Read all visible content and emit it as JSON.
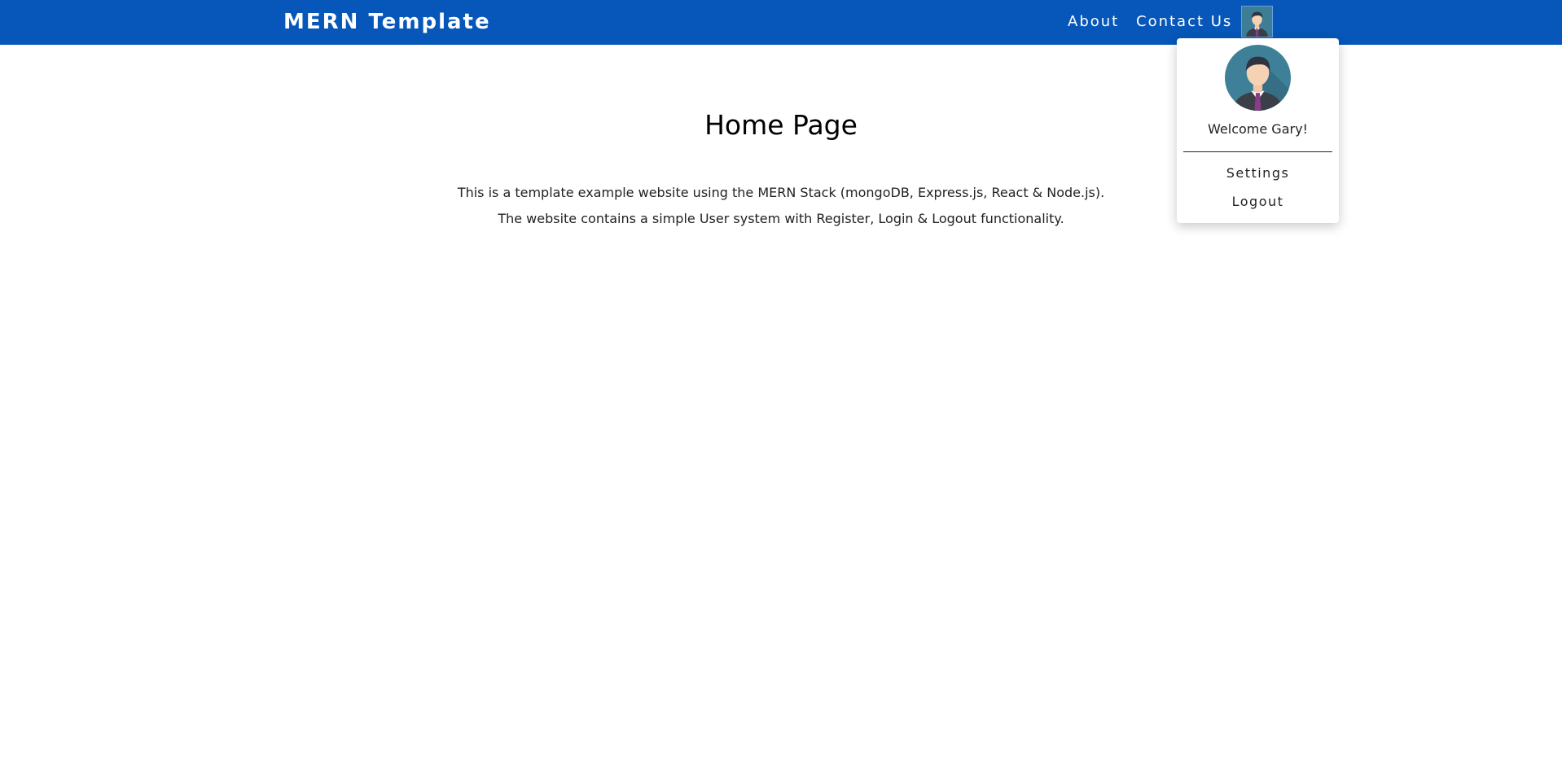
{
  "navbar": {
    "brand": "MERN Template",
    "links": [
      {
        "label": "About"
      },
      {
        "label": "Contact Us"
      }
    ],
    "background_color": "#0657b9"
  },
  "user_menu": {
    "avatar_icon": "user-avatar-icon",
    "welcome_text": "Welcome Gary!",
    "items": [
      {
        "label": "Settings"
      },
      {
        "label": "Logout"
      }
    ]
  },
  "main": {
    "title": "Home Page",
    "description_lines": [
      "This is a template example website using the MERN Stack (mongoDB, Express.js, React & Node.js).",
      "The website contains a simple User system with Register, Login & Logout functionality."
    ]
  }
}
